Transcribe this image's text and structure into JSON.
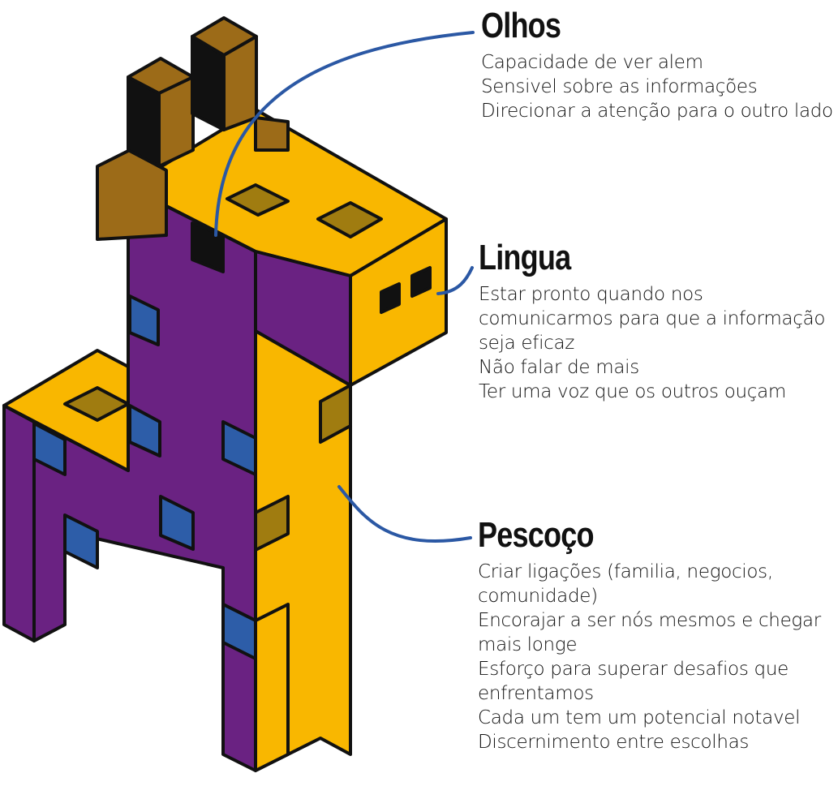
{
  "colors": {
    "purple": "#6a2282",
    "yellow": "#f9b700",
    "brown": "#9c6b18",
    "olive": "#a07c10",
    "blue": "#2d5da8",
    "line": "#2b58a4",
    "black": "#111111"
  },
  "callouts": [
    {
      "key": "olhos",
      "title": "Olhos",
      "lines": [
        "Capacidade de ver alem",
        "Sensivel sobre as informações",
        "Direcionar a atenção para o outro lado"
      ]
    },
    {
      "key": "lingua",
      "title": "Lingua",
      "lines": [
        "Estar pronto quando nos",
        "comunicarmos para que a informação",
        "seja eficaz",
        "Não falar de mais",
        "Ter uma voz que os outros ouçam"
      ]
    },
    {
      "key": "pescoco",
      "title": "Pescoço",
      "lines": [
        "Criar ligações (familia, negocios,",
        "comunidade)",
        "Encorajar a ser nós mesmos e chegar",
        "mais longe",
        "Esforço para superar desafios que",
        "enfrentamos",
        "Cada um tem um potencial notavel",
        "Discernimento entre escolhas"
      ]
    }
  ]
}
